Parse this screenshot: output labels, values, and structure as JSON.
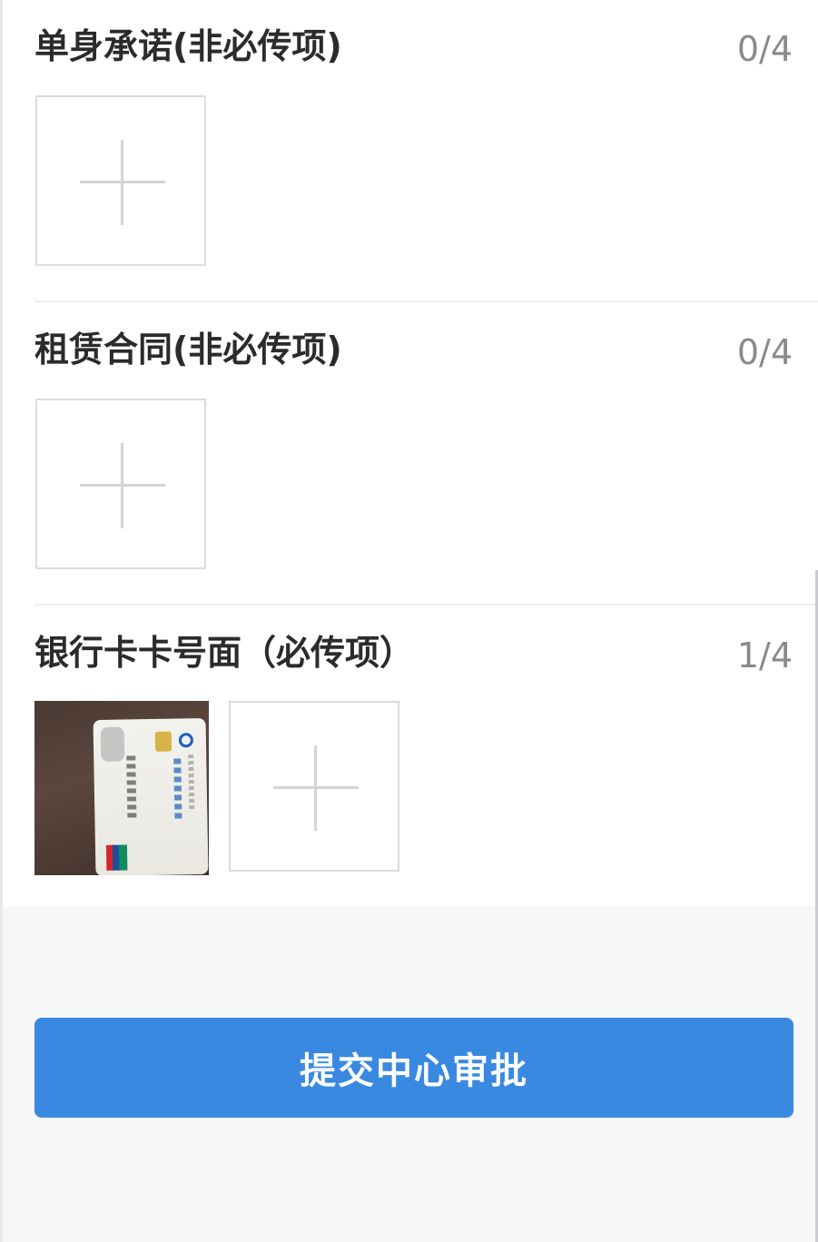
{
  "sections": [
    {
      "title": "单身承诺(非必传项)",
      "count": "0/4"
    },
    {
      "title": "租赁合同(非必传项)",
      "count": "0/4"
    },
    {
      "title": "银行卡卡号面（必传项）",
      "count": "1/4"
    }
  ],
  "submit": {
    "label": "提交中心审批"
  },
  "icons": {
    "add": "plus-icon"
  },
  "colors": {
    "primary": "#3a89e0",
    "title": "#2b2b2b",
    "count": "#8a8a8a",
    "border": "#dcdcdc"
  }
}
